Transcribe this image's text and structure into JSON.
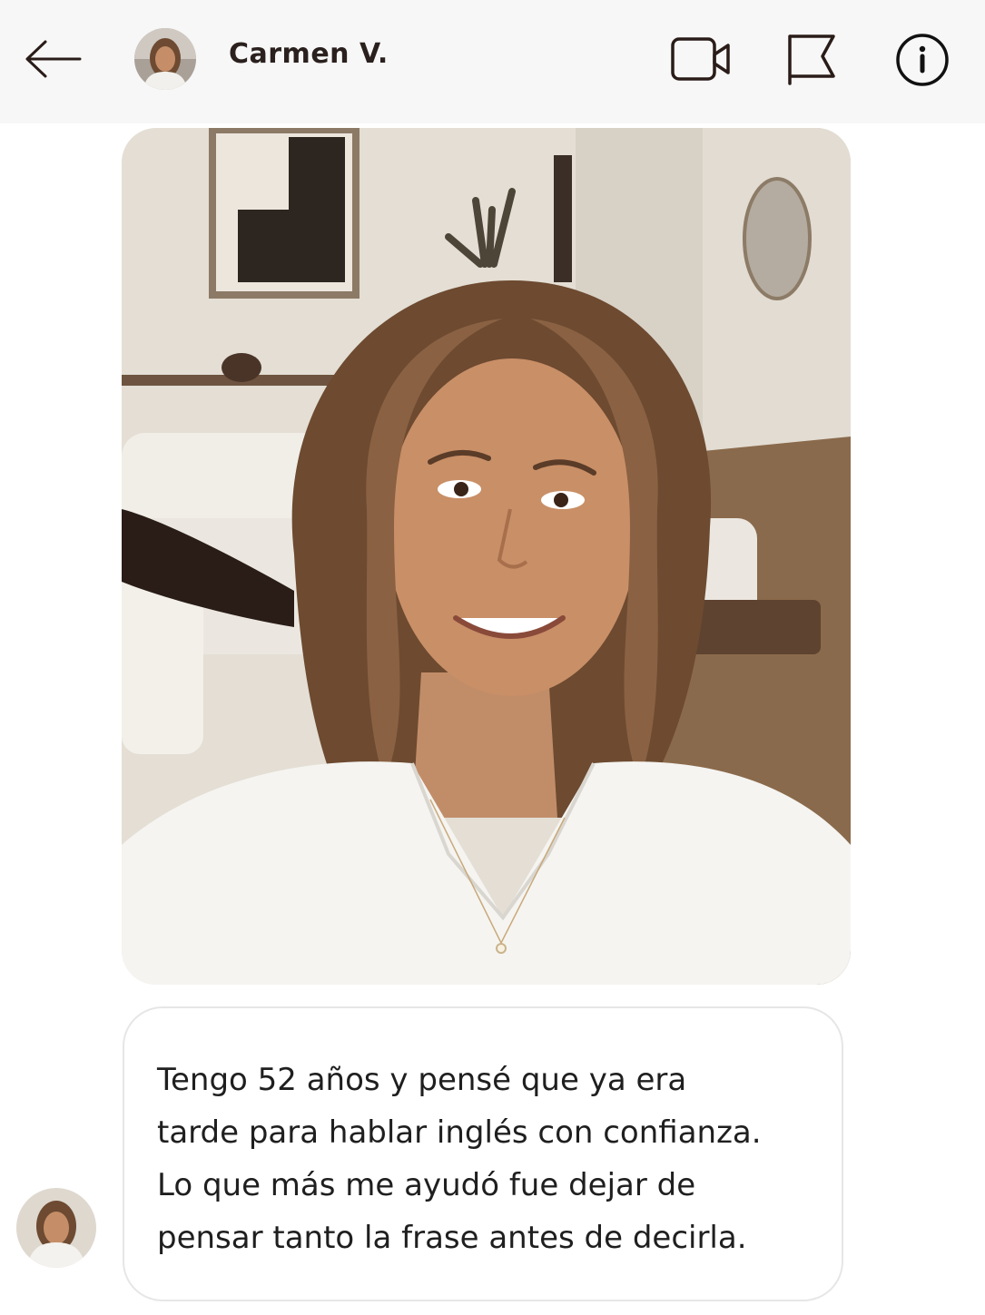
{
  "header": {
    "contact_name": "Carmen V.",
    "icons": [
      "back-arrow-icon",
      "video-camera-icon",
      "flag-icon",
      "info-icon"
    ]
  },
  "conversation": {
    "messages": [
      {
        "type": "photo",
        "content": "selfie-photo"
      },
      {
        "type": "text",
        "lines": [
          "Tengo 52 años y pensé que ya era",
          "tarde para hablar inglés con confianza.",
          "Lo que más me ayudó fue dejar de",
          "pensar tanto la frase antes de decirla."
        ]
      }
    ]
  },
  "colors": {
    "header_bg": "#f7f7f7",
    "icon_color": "#2a1c18",
    "bubble_border": "#e6e6e6",
    "text": "#1f1f1f"
  }
}
